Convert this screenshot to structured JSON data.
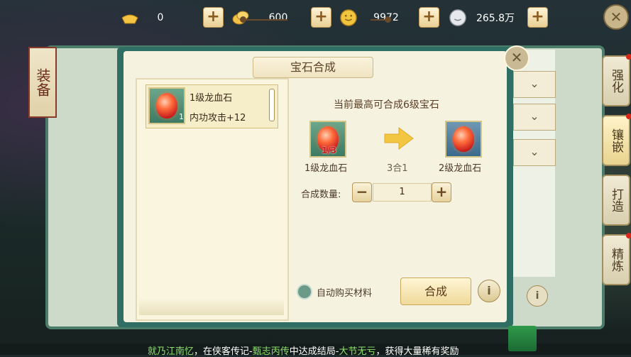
{
  "currencies": [
    {
      "icon": "gold-ingot-icon",
      "value": "0"
    },
    {
      "icon": "gold-coin-icon",
      "value": "600"
    },
    {
      "icon": "copper-coin-icon",
      "value": "9972"
    },
    {
      "icon": "silver-coin-icon",
      "value": "265.8万"
    }
  ],
  "left_tab": {
    "label": "装备"
  },
  "right_tabs": [
    {
      "label": "强化",
      "active": false,
      "badge": true
    },
    {
      "label": "镶嵌",
      "active": true,
      "badge": true
    },
    {
      "label": "打造",
      "active": false,
      "badge": false
    },
    {
      "label": "精炼",
      "active": false,
      "badge": true
    }
  ],
  "dialog": {
    "title": "宝石合成",
    "list": [
      {
        "name": "1级龙血石",
        "attr": "内功攻击+12",
        "count": "1"
      }
    ],
    "headline": "当前最高可合成6级宝石",
    "source": {
      "name": "1级龙血石",
      "progress": "1/3"
    },
    "ratio": "3合1",
    "target": {
      "name": "2级龙血石"
    },
    "quantity_label": "合成数量:",
    "quantity": "1",
    "auto_buy_label": "自动购买材料",
    "combine_label": "合成"
  },
  "marquee": {
    "parts": [
      "就乃江南忆",
      "，在侠客传记-",
      "甄志丙传",
      "中达成结局-",
      "大节无亏",
      "，获得大量稀有奖励"
    ]
  },
  "colors": {
    "dialog_frame": "#2f6e63",
    "panel_bg": "#f5f2e0",
    "accent_gold": "#efd99a"
  }
}
